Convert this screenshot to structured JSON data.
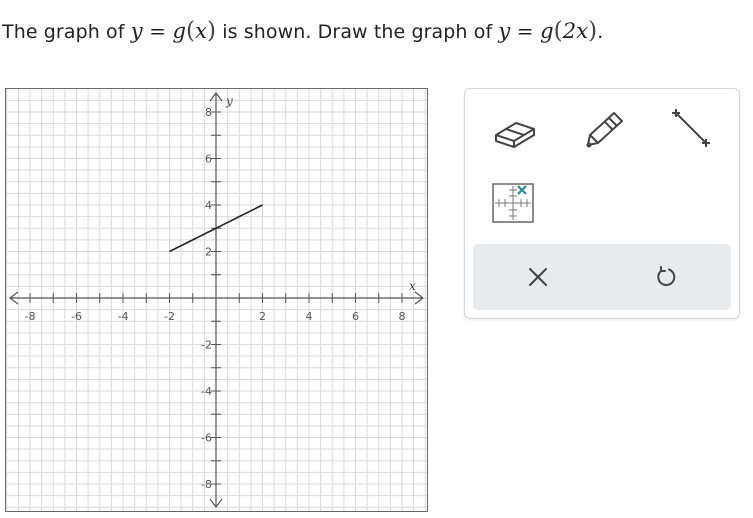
{
  "prompt": {
    "text_1": "The graph of ",
    "y1": "y",
    "eq1": " = ",
    "g1": "g",
    "x1": "x",
    "text_2": " is shown. Draw the graph of ",
    "y2": "y",
    "eq2": " = ",
    "g2": "g",
    "arg2": "2x",
    "end": "."
  },
  "graph": {
    "x_axis_label": "x",
    "y_axis_label": "y",
    "x_range": [
      -8,
      8
    ],
    "y_range": [
      -8,
      8
    ],
    "x_tick_labels": [
      "-8",
      "-6",
      "-4",
      "-2",
      "2",
      "4",
      "6",
      "8"
    ],
    "y_tick_labels": [
      "8",
      "6",
      "4",
      "2",
      "-2",
      "-4",
      "-6",
      "-8"
    ],
    "segment": {
      "from": [
        -2,
        2
      ],
      "to": [
        2,
        4
      ]
    },
    "grid_color": "#d9d9d9",
    "axis_color": "#555555",
    "line_color": "#222222"
  },
  "toolbox": {
    "tools": [
      {
        "name": "eraser-tool",
        "icon": "eraser-icon"
      },
      {
        "name": "pencil-tool",
        "icon": "pencil-icon"
      },
      {
        "name": "line-segment-tool",
        "icon": "line-segment-icon"
      },
      {
        "name": "point-grid-tool",
        "icon": "point-grid-icon"
      }
    ],
    "actions": [
      {
        "name": "clear-button",
        "icon": "x-icon"
      },
      {
        "name": "undo-button",
        "icon": "undo-icon"
      }
    ],
    "accent_color": "#2b8a9b"
  }
}
